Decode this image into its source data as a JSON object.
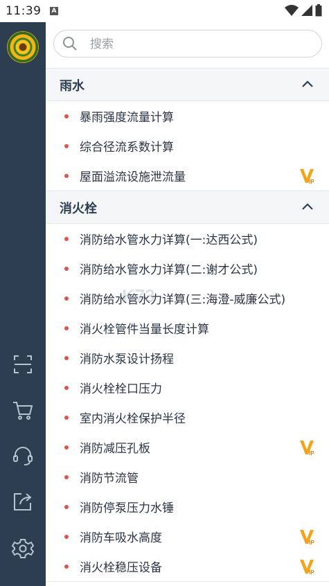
{
  "status": {
    "time": "11:39",
    "notification": "A"
  },
  "search": {
    "placeholder": "搜索"
  },
  "sections": [
    {
      "title": "雨水",
      "items": [
        {
          "label": "暴雨强度流量计算",
          "vip": false
        },
        {
          "label": "综合径流系数计算",
          "vip": false
        },
        {
          "label": "屋面溢流设施泄流量",
          "vip": true
        }
      ]
    },
    {
      "title": "消火栓",
      "items": [
        {
          "label": "消防给水管水力详算(一:达西公式)",
          "vip": false
        },
        {
          "label": "消防给水管水力详算(二:谢才公式)",
          "vip": false
        },
        {
          "label": "消防给水管水力详算(三:海澄-威廉公式)",
          "vip": false
        },
        {
          "label": "消火栓管件当量长度计算",
          "vip": false
        },
        {
          "label": "消防水泵设计扬程",
          "vip": false
        },
        {
          "label": "消火栓栓口压力",
          "vip": false
        },
        {
          "label": "室内消火栓保护半径",
          "vip": false
        },
        {
          "label": "消防减压孔板",
          "vip": true
        },
        {
          "label": "消防节流管",
          "vip": false
        },
        {
          "label": "消防停泵压力水锤",
          "vip": false
        },
        {
          "label": "消防车吸水高度",
          "vip": true
        },
        {
          "label": "消火栓稳压设备",
          "vip": true
        }
      ]
    }
  ],
  "sidebar_icons": [
    "scan-icon",
    "cart-icon",
    "headset-icon",
    "share-icon",
    "settings-icon"
  ],
  "colors": {
    "sidebar": "#2c3e50",
    "dot": "#e0524a",
    "vip": "#f2a51b",
    "header_bg": "#f5f6f8"
  }
}
